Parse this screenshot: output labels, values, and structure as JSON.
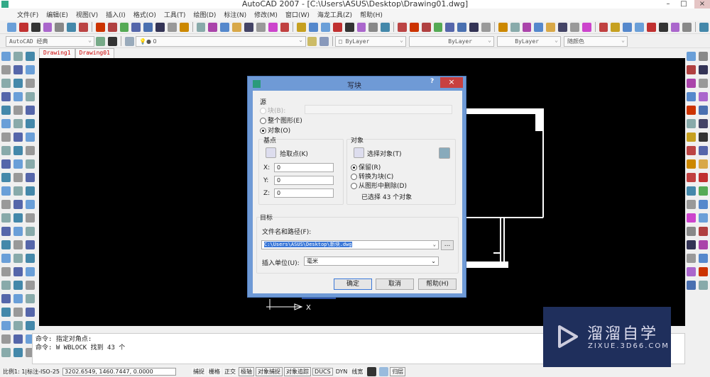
{
  "window": {
    "title": "AutoCAD 2007 - [C:\\Users\\ASUS\\Desktop\\Drawing01.dwg]"
  },
  "menu": [
    "文件(F)",
    "编辑(E)",
    "视图(V)",
    "插入(I)",
    "格式(O)",
    "工具(T)",
    "绘图(D)",
    "标注(N)",
    "修改(M)",
    "窗口(W)",
    "海龙工具(Z)",
    "帮助(H)"
  ],
  "toolbar2": {
    "workspace": "AutoCAD 经典",
    "layer": "0",
    "color": "ByLayer",
    "linetype": "ByLayer",
    "lineweight": "ByLayer",
    "plotstyle": "随颜色"
  },
  "tabs": [
    "Drawing1",
    "Drawing01"
  ],
  "dialog": {
    "title": "写块",
    "help": "?",
    "close": "×",
    "source_label": "源",
    "block_radio": "块(B):",
    "whole_radio": "整个图形(E)",
    "objects_radio": "对象(O)",
    "basepoint_label": "基点",
    "pick_point": "拾取点(K)",
    "x_label": "X:",
    "x": "0",
    "y_label": "Y:",
    "y": "0",
    "z_label": "Z:",
    "z": "0",
    "objects_label": "对象",
    "select_objects": "选择对象(T)",
    "retain": "保留(R)",
    "convert": "转换为块(C)",
    "delete": "从图形中删除(D)",
    "selected_count": "已选择 43 个对象",
    "target_label": "目标",
    "filename_label": "文件名和路径(F):",
    "filename": "C:\\Users\\ASUS\\Desktop\\新块.dwg",
    "browse": "...",
    "units_label": "插入单位(U):",
    "units": "毫米",
    "ok": "确定",
    "cancel": "取消",
    "helpbtn": "帮助(H)"
  },
  "ucs": {
    "x": "X"
  },
  "command": {
    "lines": [
      "命令: 指定对角点:",
      "命令: W WBLOCK 找到 43 个"
    ]
  },
  "status": {
    "scale": "比例1: 1|标注-ISO-25",
    "coords": "3202.6549,  1460.7447, 0.0000",
    "buttons": [
      "捕捉",
      "栅格",
      "正交",
      "极轴",
      "对象捕捉",
      "对象追踪",
      "DUCS",
      "DYN",
      "线宽"
    ],
    "layer": "归层"
  },
  "watermark": {
    "name": "溜溜自学",
    "url": "ZIXUE.3D66.COM"
  }
}
